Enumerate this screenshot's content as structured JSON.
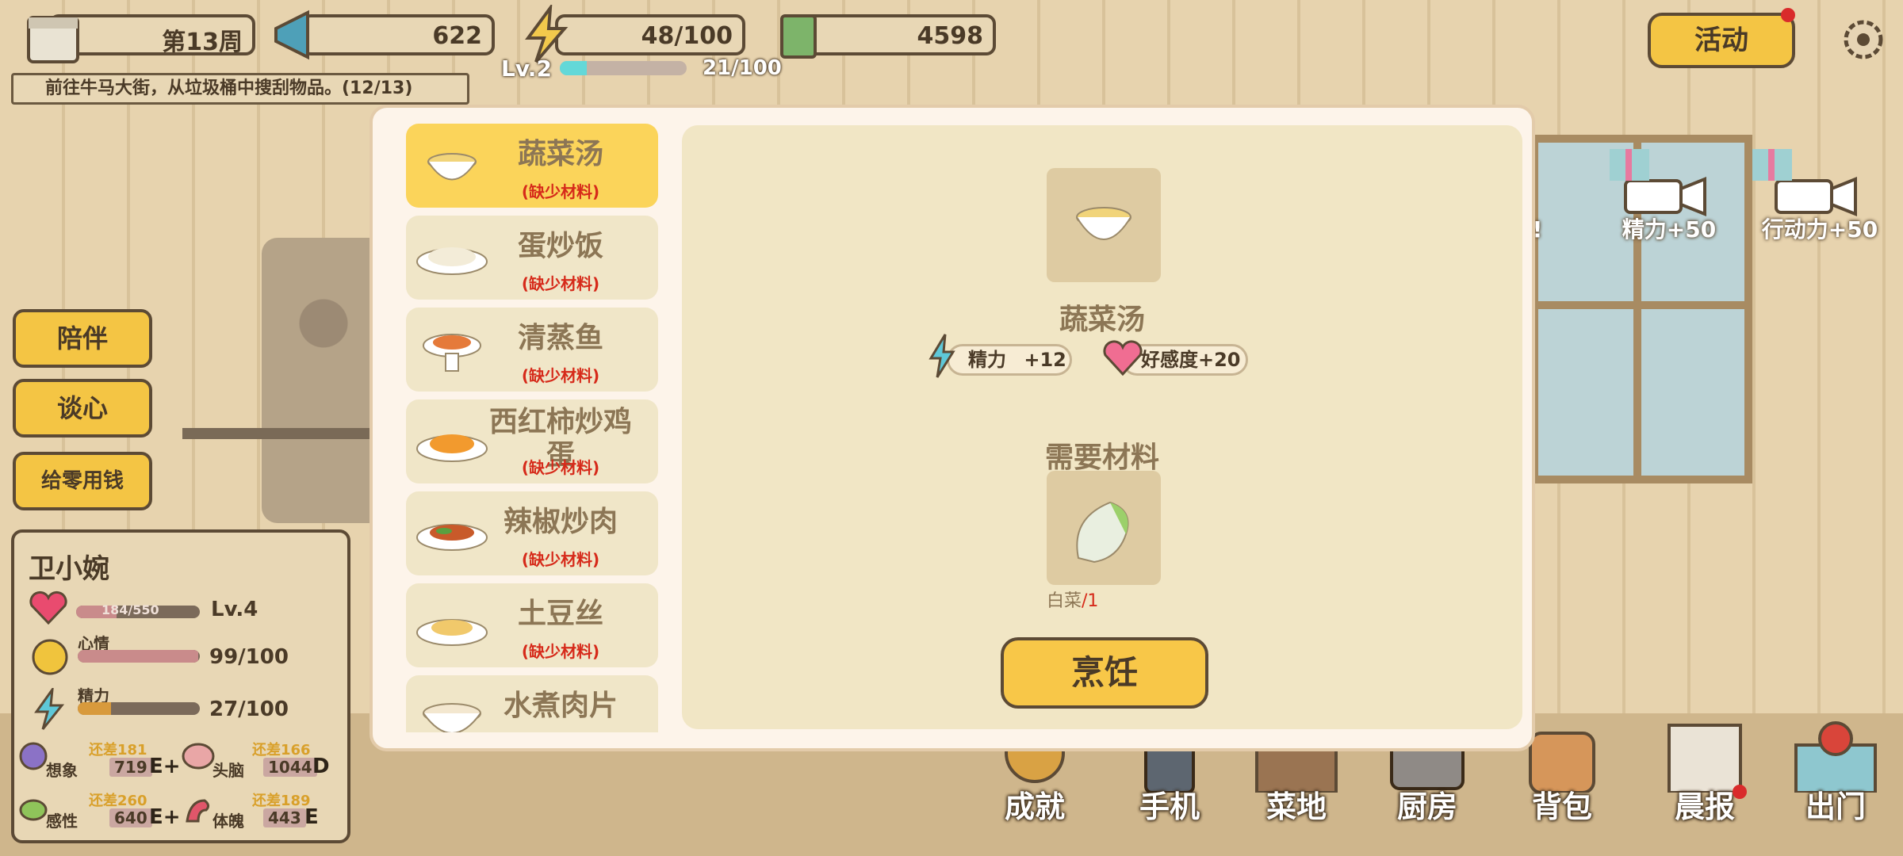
{
  "hud": {
    "week": "第13周",
    "broadcast": "622",
    "energy": "48/100",
    "money": "4598",
    "activity_label": "活动",
    "quest": "前往牛马大街，从垃圾桶中搜刮物品。(12/13)",
    "level": "Lv.2",
    "xp_text": "21/100",
    "xp_fraction": 0.21
  },
  "side_buttons": [
    "陪伴",
    "谈心",
    "给零用钱"
  ],
  "character": {
    "name": "卫小婉",
    "affection_text": "184/550",
    "affection_fraction": 0.33,
    "level": "Lv.4",
    "mood_label": "心情",
    "mood_text": "99/100",
    "mood_fraction": 0.99,
    "energy_label": "精力",
    "energy_text": "27/100",
    "energy_fraction": 0.27,
    "attributes": [
      {
        "diff": "还差181",
        "name": "想象",
        "value": "719",
        "grade": "E+"
      },
      {
        "diff": "还差166",
        "name": "头脑",
        "value": "1044",
        "grade": "D"
      },
      {
        "diff": "还差260",
        "name": "感性",
        "value": "640",
        "grade": "E+"
      },
      {
        "diff": "还差189",
        "name": "体魄",
        "value": "443",
        "grade": "E"
      }
    ]
  },
  "rewards": [
    "利!",
    "精力+50",
    "行动力+50"
  ],
  "bottom_nav": [
    "成就",
    "手机",
    "菜地",
    "厨房",
    "背包",
    "晨报",
    "出门"
  ],
  "recipes": [
    {
      "name": "蔬菜汤",
      "status": "(缺少材料)",
      "active": true
    },
    {
      "name": "蛋炒饭",
      "status": "(缺少材料)"
    },
    {
      "name": "清蒸鱼",
      "status": "(缺少材料)"
    },
    {
      "name": "西红柿炒鸡蛋",
      "status": "(缺少材料)"
    },
    {
      "name": "辣椒炒肉",
      "status": "(缺少材料)"
    },
    {
      "name": "土豆丝",
      "status": "(缺少材料)"
    },
    {
      "name": "水煮肉片",
      "status": ""
    }
  ],
  "detail": {
    "dish_name": "蔬菜汤",
    "effect_energy_label": "精力",
    "effect_energy_value": "+12",
    "effect_affection": "好感度+20",
    "need_title": "需要材料",
    "material_name": "白菜",
    "material_count": "/1",
    "cook_label": "烹饪"
  },
  "colors": {
    "accent_yellow": "#f4c544",
    "frame_brown": "#5c4a35",
    "missing_red": "#d62a1a",
    "xp_cyan": "#63d8d8"
  }
}
